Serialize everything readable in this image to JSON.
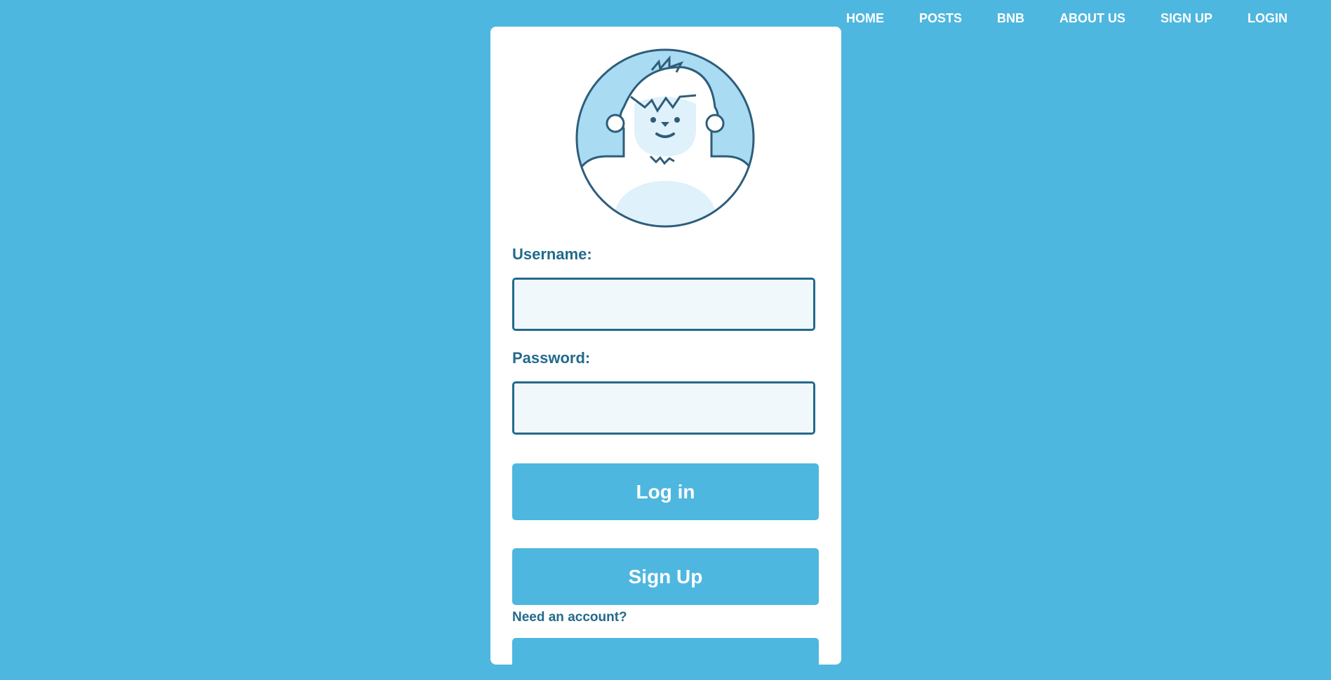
{
  "nav": {
    "items": [
      "HOME",
      "POSTS",
      "BNB",
      "ABOUT US",
      "SIGN UP",
      "LOGIN"
    ]
  },
  "login_form": {
    "username_label": "Username:",
    "username_value": "",
    "password_label": "Password:",
    "password_value": "",
    "login_button": "Log in",
    "signup_button": "Sign Up",
    "need_account": "Need an account?"
  },
  "colors": {
    "background": "#4eb7df",
    "card": "#ffffff",
    "accent_text": "#236a8c",
    "field_bg": "#f1f8fb",
    "avatar_bg": "#a9dbf2"
  },
  "icons": {
    "avatar": "yeti-avatar-icon"
  }
}
